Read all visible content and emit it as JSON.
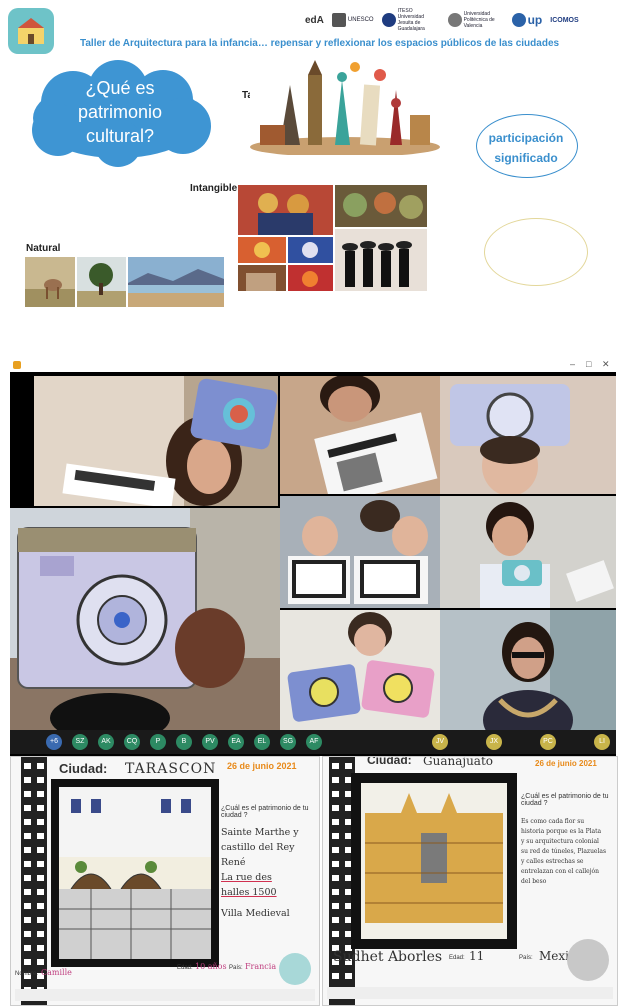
{
  "slide": {
    "partners": [
      "edA",
      "UNESCO",
      "ITESO Universidad Jesuita de Guadalajara",
      "Universidad Politécnica de Valencia",
      "up",
      "ICOMOS"
    ],
    "title": "Taller de Arquitectura para la infancia… repensar y reflexionar los espacios públicos de las ciudades",
    "cloud_line1": "¿Qué es",
    "cloud_line2": "patrimonio",
    "cloud_line3": "cultural?",
    "label_tangible": "Tangible",
    "label_intangible": "Intangible",
    "label_natural": "Natural",
    "ellipse_line1": "participación",
    "ellipse_line2": "significado"
  },
  "call": {
    "participants": [
      "+6",
      "SZ",
      "AK",
      "CQ",
      "P",
      "B",
      "PV",
      "EA",
      "EL",
      "SG",
      "AF",
      "JV",
      "JX",
      "PC",
      "LI"
    ]
  },
  "worksheet_left": {
    "city_label": "Ciudad:",
    "city_value": "TARASCON",
    "date": "26 de junio 2021",
    "question": "¿Cuál es el patrimonio de tu ciudad ?",
    "answer_lines": [
      "Sainte Marthe y",
      "castillo del Rey",
      "René",
      "La rue des",
      "halles 1500",
      "Villa Medieval"
    ],
    "name_label": "Nombre:",
    "name_value": "Camille",
    "age_label": "Edad:",
    "age_value": "10 años",
    "country_label": "País:",
    "country_value": "Francia"
  },
  "worksheet_right": {
    "city_label": "Ciudad:",
    "city_value": "Guanajuato",
    "date": "26 de junio 2021",
    "question": "¿Cuál es el patrimonio de tu ciudad ?",
    "answer_lines": [
      "Es como cada flor su",
      "historia porque es la Plata",
      "y su arquitectura colonial",
      "su red de túneles, Plazuelas",
      "y calles estrechas se",
      "entrelazan con el callejón",
      "del beso"
    ],
    "name_value": "Sudhet Aborles",
    "age_label": "Edad:",
    "age_value": "11",
    "country_label": "País:",
    "country_value": "Mexico"
  },
  "colors": {
    "accent": "#3a8fcd",
    "cloud": "#3e95d3",
    "avatar": "#2d8a63",
    "date_orange": "#e88a1a"
  }
}
